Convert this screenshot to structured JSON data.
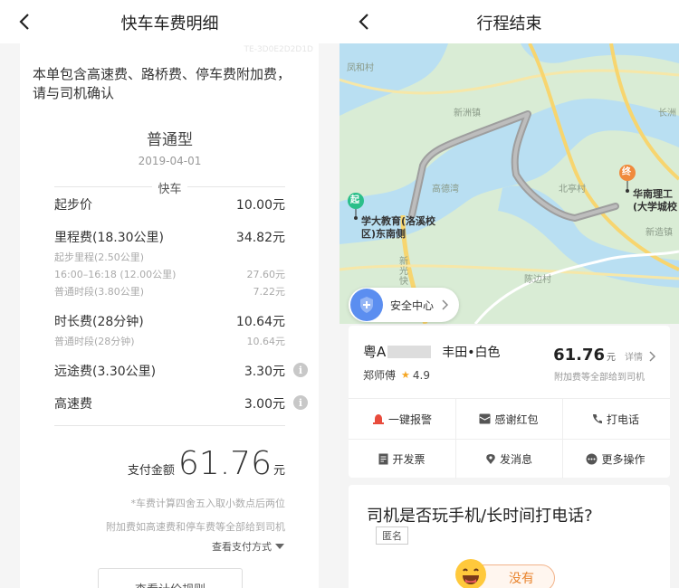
{
  "left": {
    "nav_title": "快车车费明细",
    "watermark": "TE-3D0E2D2D1D",
    "notice": "本单包含高速费、路桥费、停车费附加费，请与司机确认",
    "car_type": "普通型",
    "date": "2019-04-01",
    "section": "快车",
    "rows": {
      "base": {
        "label": "起步价",
        "value": "10.00元"
      },
      "mileage": {
        "label": "里程费(18.30公里)",
        "value": "34.82元"
      },
      "mileage_sub1": {
        "label": "起步里程(2.50公里)",
        "value": ""
      },
      "mileage_sub2": {
        "label": "16:00–16:18 (12.00公里)",
        "value": "27.60元"
      },
      "mileage_sub3": {
        "label": "普通时段(3.80公里)",
        "value": "7.22元"
      },
      "duration": {
        "label": "时长费(28分钟)",
        "value": "10.64元"
      },
      "duration_sub1": {
        "label": "普通时段(28分钟)",
        "value": "10.64元"
      },
      "longdist": {
        "label": "远途费(3.30公里)",
        "value": "3.30元"
      },
      "highway": {
        "label": "高速费",
        "value": "3.00元"
      }
    },
    "total_label": "支付金额",
    "total_value": "61.76",
    "total_unit": "元",
    "foot1": "*车费计算四舍五入取小数点后两位",
    "foot2": "附加费如高速费和停车费等全部给到司机",
    "pay_mode": "查看支付方式",
    "rules_button": "查看计价规则"
  },
  "right": {
    "nav_title": "行程结束",
    "map_labels": {
      "l1": "凤和村",
      "l2": "新洲镇",
      "l3": "长洲",
      "l4": "高德湾",
      "l5": "北亭村",
      "l6": "新造镇",
      "l7": "陈边村",
      "l8": "新光快"
    },
    "start_pin": "起",
    "end_pin": "终",
    "start_label": "学大教育(洛溪校区)东南侧",
    "end_label": "华南理工(大学城校",
    "safety": "安全中心",
    "plate_prefix": "粤A",
    "car": "丰田•白色",
    "driver": "郑师傅",
    "rating": "4.9",
    "price": "61.76",
    "price_unit": "元",
    "detail": "详情",
    "price_note": "附加费等全部给到司机",
    "actions": [
      "一键报警",
      "感谢红包",
      "打电话",
      "开发票",
      "发消息",
      "更多操作"
    ],
    "question": "司机是否玩手机/长时间打电话?",
    "anon": "匿名",
    "answer": "没有"
  }
}
